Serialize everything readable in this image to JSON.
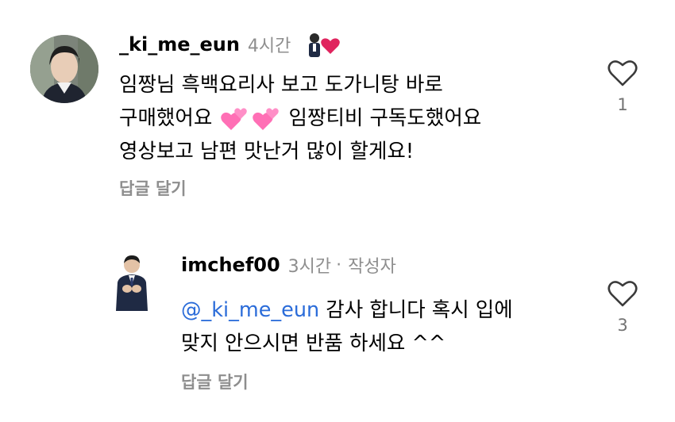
{
  "comments": [
    {
      "username": "_ki_me_eun",
      "time": "4시간",
      "lines": [
        "임짱님 흑백요리사 보고 도가니탕 바로",
        "구매했어요",
        "임짱티비 구독도했어요",
        "영상보고 남편 맛난거 많이 할게요!"
      ],
      "reply_label": "답글 달기",
      "like_count": "1",
      "liked_by_creator": true
    },
    {
      "username": "imchef00",
      "time": "3시간",
      "separator": "·",
      "author_label": "작성자",
      "mention": "@_ki_me_eun",
      "lines": [
        "감사 합니다 혹시 입에",
        "맞지 안으시면 반품 하세요 ^^"
      ],
      "reply_label": "답글 달기",
      "like_count": "3"
    }
  ],
  "icons": {
    "like": "heart-outline-icon",
    "creator_heart": "creator-heart-icon",
    "emoji": "two-hearts-emoji",
    "mention": "threads-at-icon"
  },
  "colors": {
    "mention": "#2b6cd9",
    "secondary_text": "#8e8e8e",
    "creator_heart": "#e0245e",
    "emoji_pink": "#ff6fb5"
  }
}
